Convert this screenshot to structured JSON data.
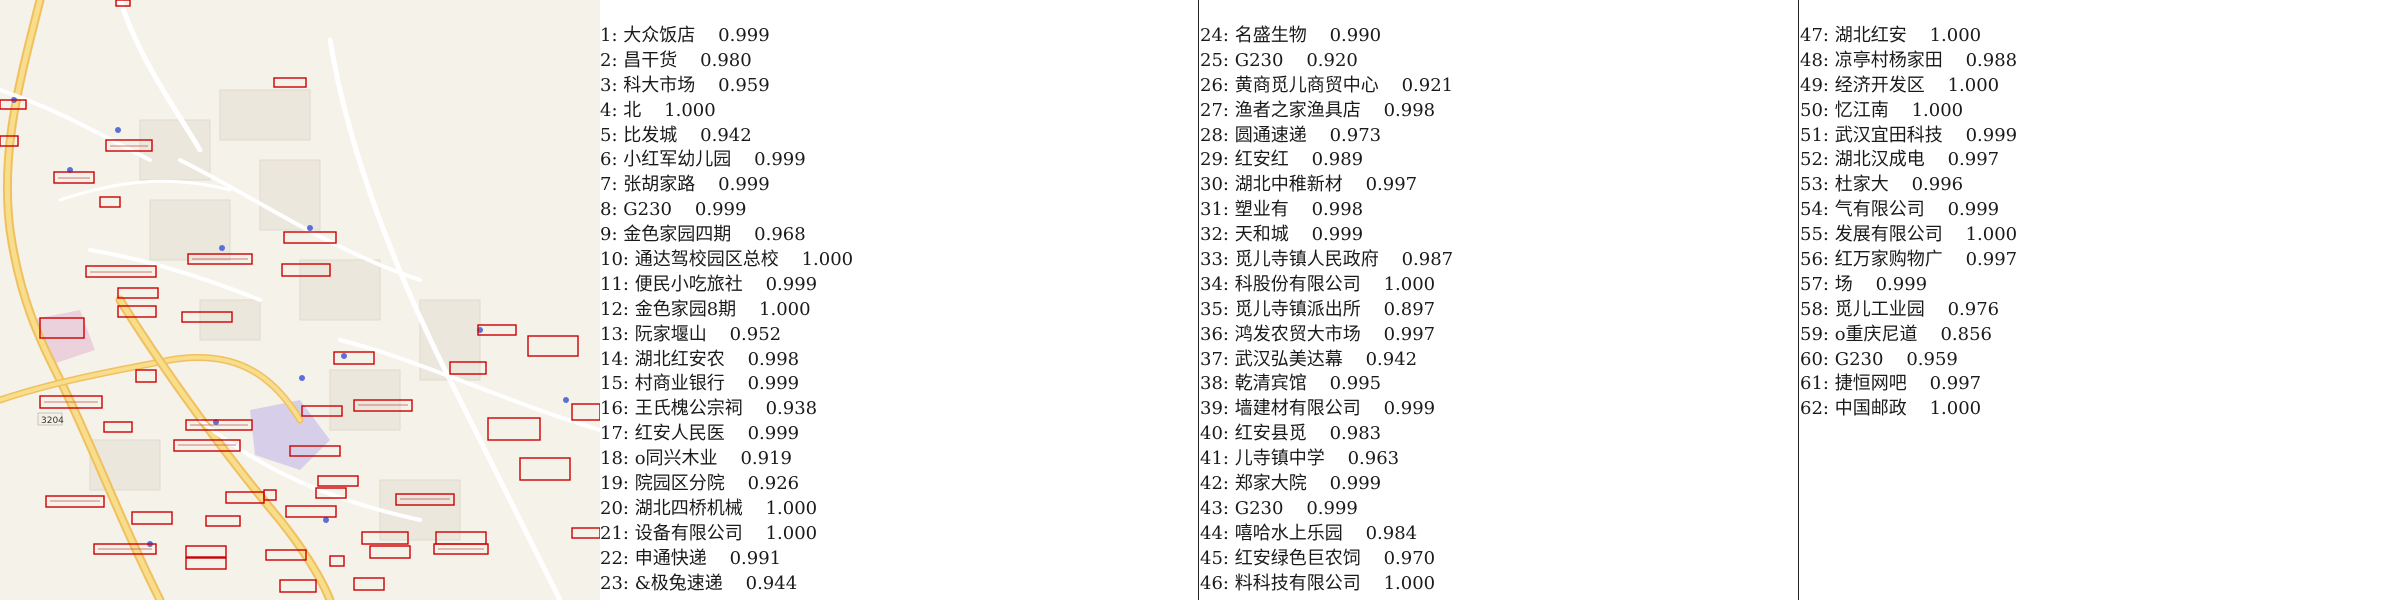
{
  "map": {
    "road_label": "3204",
    "poi_icon_color": "#5b6fd6",
    "box_color": "#cc0000"
  },
  "results": [
    {
      "idx": "1:",
      "name": "大众饭店",
      "score": "0.999"
    },
    {
      "idx": "2:",
      "name": "昌干货",
      "score": "0.980"
    },
    {
      "idx": "3:",
      "name": "科大市场",
      "score": "0.959"
    },
    {
      "idx": "4:",
      "name": "北",
      "score": "1.000"
    },
    {
      "idx": "5:",
      "name": "比发城",
      "score": "0.942"
    },
    {
      "idx": "6:",
      "name": "小红军幼儿园",
      "score": "0.999"
    },
    {
      "idx": "7:",
      "name": "张胡家路",
      "score": "0.999"
    },
    {
      "idx": "8:",
      "name": "G230",
      "score": "0.999"
    },
    {
      "idx": "9:",
      "name": "金色家园四期",
      "score": "0.968"
    },
    {
      "idx": "10:",
      "name": "通达驾校园区总校",
      "score": "1.000"
    },
    {
      "idx": "11:",
      "name": "便民小吃旅社",
      "score": "0.999"
    },
    {
      "idx": "12:",
      "name": "金色家园8期",
      "score": "1.000"
    },
    {
      "idx": "13:",
      "name": "阮家堰山",
      "score": "0.952"
    },
    {
      "idx": "14:",
      "name": "湖北红安农",
      "score": "0.998"
    },
    {
      "idx": "15:",
      "name": "村商业银行",
      "score": "0.999"
    },
    {
      "idx": "16:",
      "name": "王氏槐公宗祠",
      "score": "0.938"
    },
    {
      "idx": "17:",
      "name": "红安人民医",
      "score": "0.999"
    },
    {
      "idx": "18:",
      "name": "o同兴木业",
      "score": "0.919"
    },
    {
      "idx": "19:",
      "name": "院园区分院",
      "score": "0.926"
    },
    {
      "idx": "20:",
      "name": "湖北四桥机械",
      "score": "1.000"
    },
    {
      "idx": "21:",
      "name": "设备有限公司",
      "score": "1.000"
    },
    {
      "idx": "22:",
      "name": "申通快递",
      "score": "0.991"
    },
    {
      "idx": "23:",
      "name": "&极兔速递",
      "score": "0.944"
    },
    {
      "idx": "24:",
      "name": "名盛生物",
      "score": "0.990"
    },
    {
      "idx": "25:",
      "name": "G230",
      "score": "0.920"
    },
    {
      "idx": "26:",
      "name": "黄商觅儿商贸中心",
      "score": "0.921"
    },
    {
      "idx": "27:",
      "name": "渔者之家渔具店",
      "score": "0.998"
    },
    {
      "idx": "28:",
      "name": "圆通速递",
      "score": "0.973"
    },
    {
      "idx": "29:",
      "name": "红安红",
      "score": "0.989"
    },
    {
      "idx": "30:",
      "name": "湖北中稚新材",
      "score": "0.997"
    },
    {
      "idx": "31:",
      "name": "塑业有",
      "score": "0.998"
    },
    {
      "idx": "32:",
      "name": "天和城",
      "score": "0.999"
    },
    {
      "idx": "33:",
      "name": "觅儿寺镇人民政府",
      "score": "0.987"
    },
    {
      "idx": "34:",
      "name": "科股份有限公司",
      "score": "1.000"
    },
    {
      "idx": "35:",
      "name": "觅儿寺镇派出所",
      "score": "0.897"
    },
    {
      "idx": "36:",
      "name": "鸿发农贸大市场",
      "score": "0.997"
    },
    {
      "idx": "37:",
      "name": "武汉弘美达幕",
      "score": "0.942"
    },
    {
      "idx": "38:",
      "name": "乾清宾馆",
      "score": "0.995"
    },
    {
      "idx": "39:",
      "name": "墙建材有限公司",
      "score": "0.999"
    },
    {
      "idx": "40:",
      "name": "红安县觅",
      "score": "0.983"
    },
    {
      "idx": "41:",
      "name": "儿寺镇中学",
      "score": "0.963"
    },
    {
      "idx": "42:",
      "name": "郑家大院",
      "score": "0.999"
    },
    {
      "idx": "43:",
      "name": "G230",
      "score": "0.999"
    },
    {
      "idx": "44:",
      "name": "嘻哈水上乐园",
      "score": "0.984"
    },
    {
      "idx": "45:",
      "name": "红安绿色巨农饲",
      "score": "0.970"
    },
    {
      "idx": "46:",
      "name": "料科技有限公司",
      "score": "1.000"
    },
    {
      "idx": "47:",
      "name": "湖北红安",
      "score": "1.000"
    },
    {
      "idx": "48:",
      "name": "凉亭村杨家田",
      "score": "0.988"
    },
    {
      "idx": "49:",
      "name": "经济开发区",
      "score": "1.000"
    },
    {
      "idx": "50:",
      "name": "忆江南",
      "score": "1.000"
    },
    {
      "idx": "51:",
      "name": "武汉宜田科技",
      "score": "0.999"
    },
    {
      "idx": "52:",
      "name": "湖北汉成电",
      "score": "0.997"
    },
    {
      "idx": "53:",
      "name": "杜家大",
      "score": "0.996"
    },
    {
      "idx": "54:",
      "name": "气有限公司",
      "score": "0.999"
    },
    {
      "idx": "55:",
      "name": "发展有限公司",
      "score": "1.000"
    },
    {
      "idx": "56:",
      "name": "红万家购物广",
      "score": "0.997"
    },
    {
      "idx": "57:",
      "name": "场",
      "score": "0.999"
    },
    {
      "idx": "58:",
      "name": "觅儿工业园",
      "score": "0.976"
    },
    {
      "idx": "59:",
      "name": "o重庆尼道",
      "score": "0.856"
    },
    {
      "idx": "60:",
      "name": "G230",
      "score": "0.959"
    },
    {
      "idx": "61:",
      "name": "捷恒网吧",
      "score": "0.997"
    },
    {
      "idx": "62:",
      "name": "中国邮政",
      "score": "1.000"
    }
  ]
}
